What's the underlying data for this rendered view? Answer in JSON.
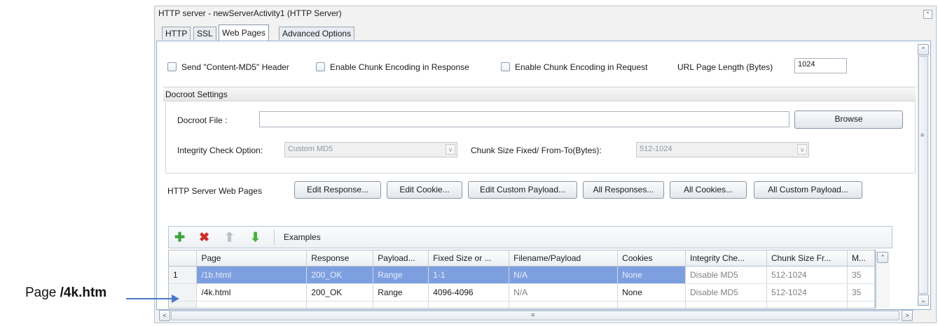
{
  "window": {
    "title": "HTTP server - newServerActivity1 (HTTP Server)",
    "collapse_glyph": "⌃"
  },
  "tabs": [
    {
      "label": "HTTP",
      "active": false
    },
    {
      "label": "SSL",
      "active": false
    },
    {
      "label": "Web Pages",
      "active": true
    },
    {
      "label": "Advanced Options",
      "active": false
    }
  ],
  "options": {
    "send_md5": "Send \"Content-MD5\" Header",
    "chunk_response": "Enable Chunk Encoding in Response",
    "chunk_request": "Enable Chunk Encoding in Request",
    "url_len_label": "URL Page Length (Bytes)",
    "url_len_value": "1024"
  },
  "docroot": {
    "section_title": "Docroot Settings",
    "file_label": "Docroot File :",
    "file_value": "",
    "browse_label": "Browse",
    "integrity_label": "Integrity Check Option:",
    "integrity_value": "Custom MD5",
    "chunk_label": "Chunk Size Fixed/ From-To(Bytes):",
    "chunk_value": "512-1024"
  },
  "web_pages": {
    "label": "HTTP Server Web Pages",
    "buttons": [
      "Edit Response...",
      "Edit Cookie...",
      "Edit Custom Payload...",
      "All Responses...",
      "All Cookies...",
      "All Custom Payload..."
    ]
  },
  "toolbar": {
    "add_glyph": "✚",
    "delete_glyph": "✖",
    "up_glyph": "⬆",
    "down_glyph": "⬇",
    "examples_label": "Examples",
    "colors": {
      "add": "#3da23d",
      "delete": "#d12b2b",
      "up": "#b8bfc6",
      "down": "#4caf3a"
    }
  },
  "table": {
    "columns": [
      "Page",
      "Response",
      "Payload...",
      "Fixed Size or ...",
      "Filename/Payload",
      "Cookies",
      "Integrity Che...",
      "Chunk Size Fr...",
      "M..."
    ],
    "rows": [
      {
        "num": "1",
        "cells": [
          "/1b.html",
          "200_OK",
          "Range",
          "1-1",
          "N/A",
          "None",
          "Disable MD5",
          "512-1024",
          "35"
        ]
      },
      {
        "num": "",
        "cells": [
          "/4k.html",
          "200_OK",
          "Range",
          "4096-4096",
          "N/A",
          "None",
          "Disable MD5",
          "512-1024",
          "35"
        ]
      }
    ]
  },
  "scroll_glyphs": {
    "up": "⌃",
    "down": "⌄",
    "left": "<",
    "right": ">",
    "grip": "≡"
  },
  "annotation": {
    "prefix": "Page ",
    "bold": "/4k.htm"
  },
  "selection_color": "#7d9fe0"
}
